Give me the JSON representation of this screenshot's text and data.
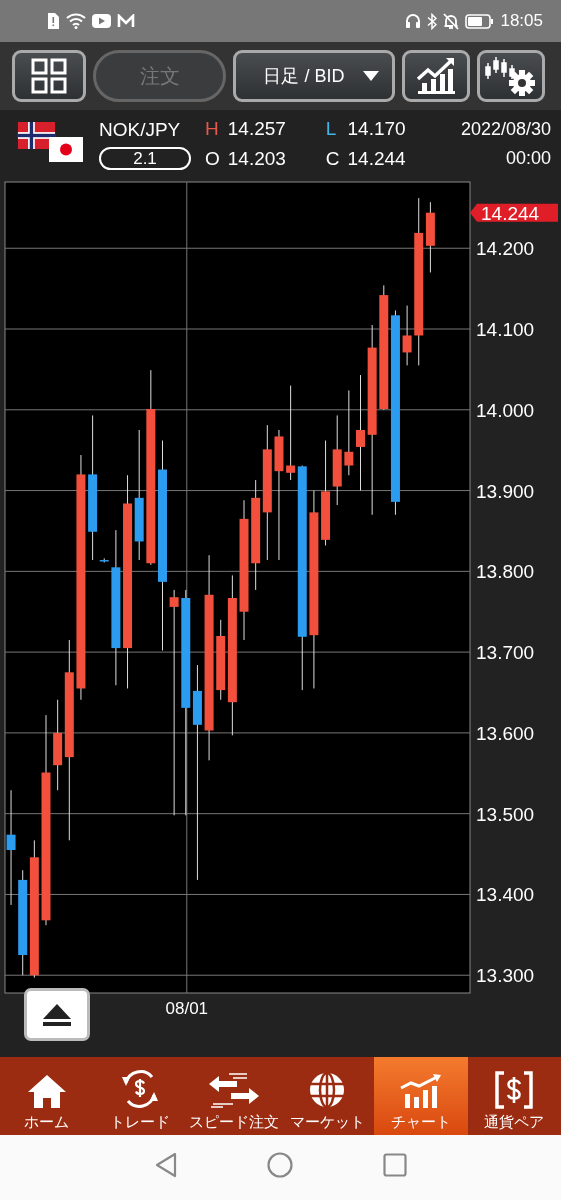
{
  "status_bar": {
    "time": "18:05"
  },
  "toolbar": {
    "order_button": {
      "label": "注文",
      "disabled": true
    },
    "timeframe_dropdown": {
      "value": "日足 / BID"
    }
  },
  "quote": {
    "pair": "NOK/JPY",
    "spread": "2.1",
    "high_label": "H",
    "high": "14.257",
    "low_label": "L",
    "low": "14.170",
    "open_label": "O",
    "open": "14.203",
    "close_label": "C",
    "close": "14.244",
    "date": "2022/08/30",
    "time": "00:00"
  },
  "chart": {
    "price_tag": "14.244",
    "chart_data": {
      "type": "candlestick",
      "grid": true,
      "ylim": [
        13.278,
        14.282
      ],
      "yticks": [
        {
          "value": 14.2,
          "label": "14.200"
        },
        {
          "value": 14.1,
          "label": "14.100"
        },
        {
          "value": 14.0,
          "label": "14.000"
        },
        {
          "value": 13.9,
          "label": "13.900"
        },
        {
          "value": 13.8,
          "label": "13.800"
        },
        {
          "value": 13.7,
          "label": "13.700"
        },
        {
          "value": 13.6,
          "label": "13.600"
        },
        {
          "value": 13.5,
          "label": "13.500"
        },
        {
          "value": 13.4,
          "label": "13.400"
        },
        {
          "value": 13.3,
          "label": "13.300"
        }
      ],
      "annotations": [
        "08/01"
      ],
      "ohlc": [
        [
          13.474,
          13.529,
          13.387,
          13.455
        ],
        [
          13.418,
          13.43,
          13.3,
          13.325
        ],
        [
          13.3,
          13.467,
          13.297,
          13.446
        ],
        [
          13.368,
          13.622,
          13.362,
          13.551
        ],
        [
          13.56,
          13.641,
          13.529,
          13.6
        ],
        [
          13.57,
          13.715,
          13.467,
          13.675
        ],
        [
          13.655,
          13.944,
          13.641,
          13.92
        ],
        [
          13.92,
          13.993,
          13.814,
          13.849
        ],
        [
          13.814,
          13.816,
          13.811,
          13.813
        ],
        [
          13.805,
          13.851,
          13.659,
          13.705
        ],
        [
          13.705,
          13.919,
          13.655,
          13.884
        ],
        [
          13.891,
          13.975,
          13.814,
          13.837
        ],
        [
          13.81,
          14.049,
          13.808,
          14.001
        ],
        [
          13.926,
          13.962,
          13.702,
          13.787
        ],
        [
          13.756,
          13.777,
          13.498,
          13.768
        ],
        [
          13.767,
          13.777,
          13.498,
          13.631
        ],
        [
          13.652,
          13.684,
          13.418,
          13.61
        ],
        [
          13.603,
          13.82,
          13.566,
          13.771
        ],
        [
          13.653,
          13.74,
          13.641,
          13.72
        ],
        [
          13.638,
          13.795,
          13.597,
          13.767
        ],
        [
          13.75,
          13.888,
          13.715,
          13.865
        ],
        [
          13.81,
          13.913,
          13.777,
          13.891
        ],
        [
          13.873,
          13.981,
          13.814,
          13.951
        ],
        [
          13.924,
          13.975,
          13.814,
          13.967
        ],
        [
          13.922,
          14.03,
          13.913,
          13.931
        ],
        [
          13.93,
          13.931,
          13.653,
          13.719
        ],
        [
          13.721,
          13.9,
          13.655,
          13.873
        ],
        [
          13.839,
          13.962,
          13.832,
          13.899
        ],
        [
          13.905,
          13.993,
          13.882,
          13.951
        ],
        [
          13.931,
          14.024,
          13.919,
          13.948
        ],
        [
          13.954,
          14.043,
          13.9,
          13.975
        ],
        [
          13.969,
          14.105,
          13.87,
          14.077
        ],
        [
          14.001,
          14.154,
          14.0,
          14.142
        ],
        [
          14.117,
          14.123,
          13.87,
          13.886
        ],
        [
          14.071,
          14.129,
          14.055,
          14.092
        ],
        [
          14.092,
          14.262,
          14.055,
          14.219
        ],
        [
          14.203,
          14.257,
          14.17,
          14.244
        ]
      ]
    }
  },
  "tabs": [
    {
      "kind": "home",
      "label": "ホーム",
      "selected": false
    },
    {
      "kind": "trade",
      "label": "トレード",
      "selected": false
    },
    {
      "kind": "speed",
      "label": "スピード注文",
      "selected": false
    },
    {
      "kind": "market",
      "label": "マーケット",
      "selected": false
    },
    {
      "kind": "chart",
      "label": "チャート",
      "selected": true
    },
    {
      "kind": "pair",
      "label": "通貨ペア",
      "selected": false
    }
  ]
}
